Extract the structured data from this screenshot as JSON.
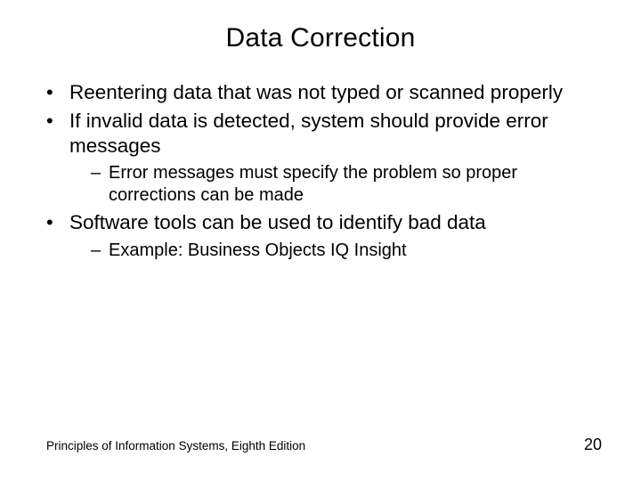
{
  "title": "Data Correction",
  "bullets": {
    "b0": "Reentering data that was not typed or scanned properly",
    "b1": "If invalid data is detected, system should provide error messages",
    "b1_0": "Error messages must specify the problem so proper corrections can be made",
    "b2": "Software tools can be used to identify bad data",
    "b2_0": "Example: Business Objects IQ Insight"
  },
  "footer": {
    "source": "Principles of Information Systems, Eighth Edition",
    "page": "20"
  }
}
